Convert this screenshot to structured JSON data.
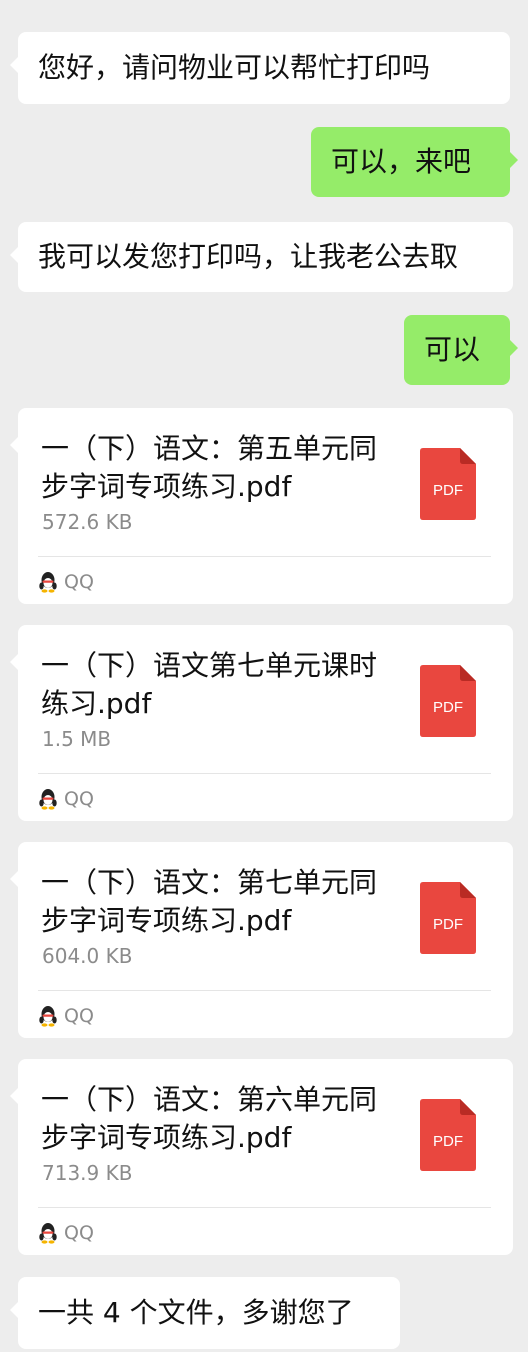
{
  "messages": [
    {
      "side": "left",
      "text": "您好，请问物业可以帮忙打印吗"
    },
    {
      "side": "right",
      "text": "可以，来吧"
    },
    {
      "side": "left",
      "text": "我可以发您打印吗，让我老公去取"
    },
    {
      "side": "right",
      "text": "可以"
    }
  ],
  "files": [
    {
      "name": "一（下）语文：第五单元同步字词专项练习.pdf",
      "size": "572.6 KB",
      "icon_label": "PDF",
      "source": "QQ"
    },
    {
      "name": "一（下）语文第七单元课时练习.pdf",
      "size": "1.5 MB",
      "icon_label": "PDF",
      "source": "QQ"
    },
    {
      "name": "一（下）语文：第七单元同步字词专项练习.pdf",
      "size": "604.0 KB",
      "icon_label": "PDF",
      "source": "QQ"
    },
    {
      "name": "一（下）语文：第六单元同步字词专项练习.pdf",
      "size": "713.9 KB",
      "icon_label": "PDF",
      "source": "QQ"
    }
  ],
  "final_message": {
    "side": "left",
    "text": "一共 4 个文件，多谢您了"
  },
  "colors": {
    "background": "#ededed",
    "incoming_bubble": "#ffffff",
    "outgoing_bubble": "#95ec69",
    "pdf_red": "#e9473f",
    "pdf_fold": "#b92b24"
  },
  "icons": {
    "file_icon": "pdf-file-icon",
    "source_icon": "qq-penguin-icon"
  }
}
